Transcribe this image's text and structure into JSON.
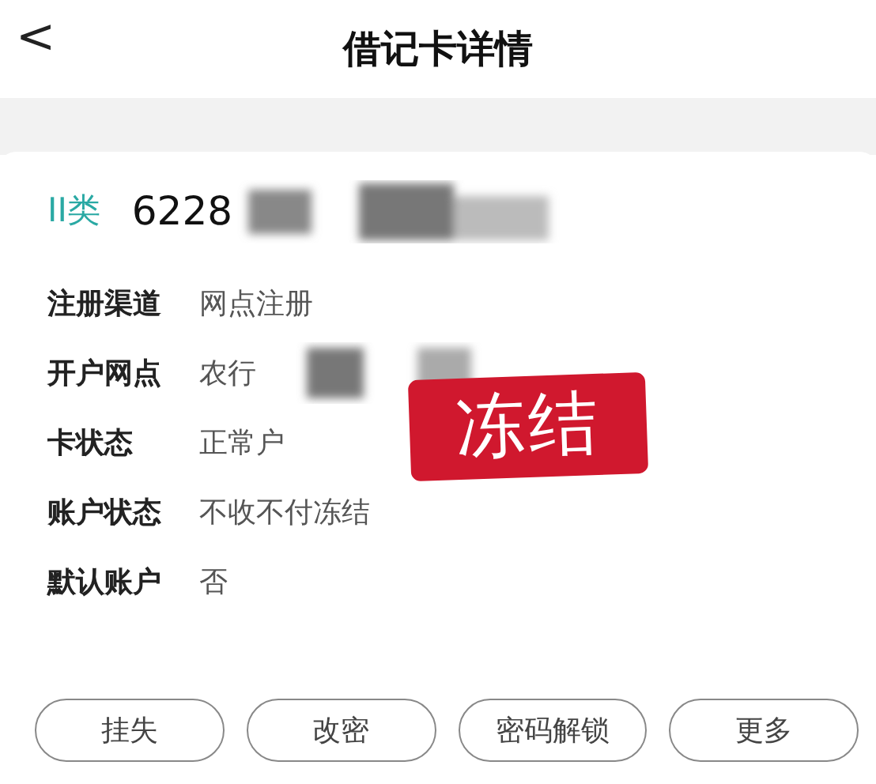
{
  "header": {
    "back": "<",
    "title": "借记卡详情"
  },
  "card": {
    "type": "II类",
    "number": "6228"
  },
  "details": [
    {
      "label": "注册渠道",
      "value": "网点注册"
    },
    {
      "label": "开户网点",
      "value": "农行"
    },
    {
      "label": "卡状态",
      "value": "正常户"
    },
    {
      "label": "账户状态",
      "value": "不收不付冻结"
    },
    {
      "label": "默认账户",
      "value": "否"
    }
  ],
  "stamp": "冻结",
  "buttons": [
    "挂失",
    "改密",
    "密码解锁",
    "更多"
  ]
}
